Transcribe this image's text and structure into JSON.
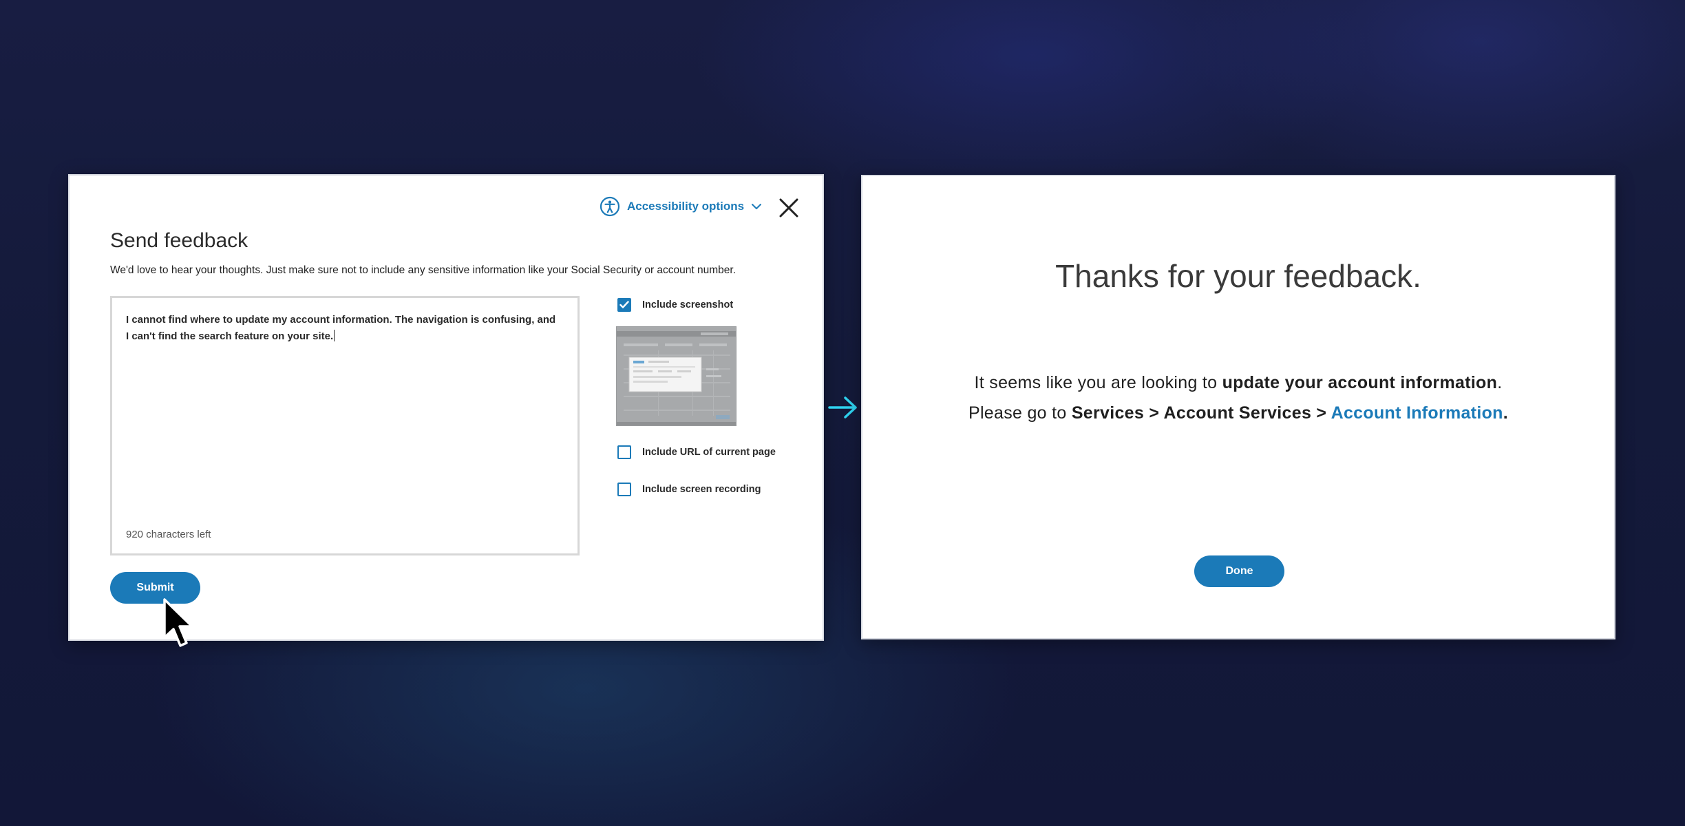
{
  "feedback": {
    "accessibility_label": "Accessibility options",
    "title": "Send feedback",
    "subtitle": "We'd love to hear your thoughts. Just make sure not to include any sensitive information like your Social Security or account number.",
    "textarea_value": "I cannot find where to update my account information. The navigation is confusing, and I can't find the search feature on your site.",
    "char_count": "920 characters left",
    "options": [
      {
        "label": "Include screenshot",
        "checked": true
      },
      {
        "label": "Include URL of current page",
        "checked": false
      },
      {
        "label": "Include screen recording",
        "checked": false
      }
    ],
    "submit_label": "Submit"
  },
  "thanks": {
    "title": "Thanks for your feedback.",
    "line1_prefix": "It seems like you are looking to ",
    "line1_bold": "update your account information",
    "line1_suffix": ".",
    "line2_prefix": "Please go to ",
    "line2_path": "Services > Account Services > ",
    "line2_link": "Account Information",
    "line2_suffix": ".",
    "done_label": "Done"
  },
  "colors": {
    "accent": "#1b7ab8",
    "arrow": "#2fd3f0",
    "background": "#161b3e"
  },
  "icons": {
    "accessibility": "accessibility-person-icon",
    "chevron": "chevron-down-icon",
    "close": "close-x-icon",
    "check": "checkmark-icon",
    "arrow": "arrow-right-icon",
    "cursor": "mouse-pointer-icon"
  }
}
